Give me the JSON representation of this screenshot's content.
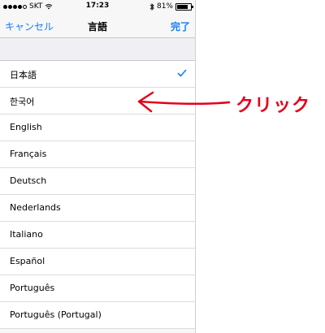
{
  "status_bar": {
    "carrier": "SKT",
    "time": "17:23",
    "battery": "81%",
    "battery_level": 0.81,
    "signal_bars": 4
  },
  "nav": {
    "cancel_label": "キャンセル",
    "title": "言語",
    "done_label": "完了"
  },
  "languages": [
    {
      "label": "日本語",
      "selected": true
    },
    {
      "label": "한국어",
      "selected": false
    },
    {
      "label": "English",
      "selected": false
    },
    {
      "label": "Français",
      "selected": false
    },
    {
      "label": "Deutsch",
      "selected": false
    },
    {
      "label": "Nederlands",
      "selected": false
    },
    {
      "label": "Italiano",
      "selected": false
    },
    {
      "label": "Español",
      "selected": false
    },
    {
      "label": "Português",
      "selected": false
    },
    {
      "label": "Português (Portugal)",
      "selected": false
    }
  ],
  "annotation": {
    "text": "クリック",
    "color": "#e3001b"
  },
  "colors": {
    "accent": "#157efb",
    "annotation": "#e3001b"
  },
  "icons": {
    "selected_marker": "checkmark-icon",
    "wifi": "wifi-icon",
    "bluetooth": "bluetooth-icon",
    "battery": "battery-icon"
  }
}
